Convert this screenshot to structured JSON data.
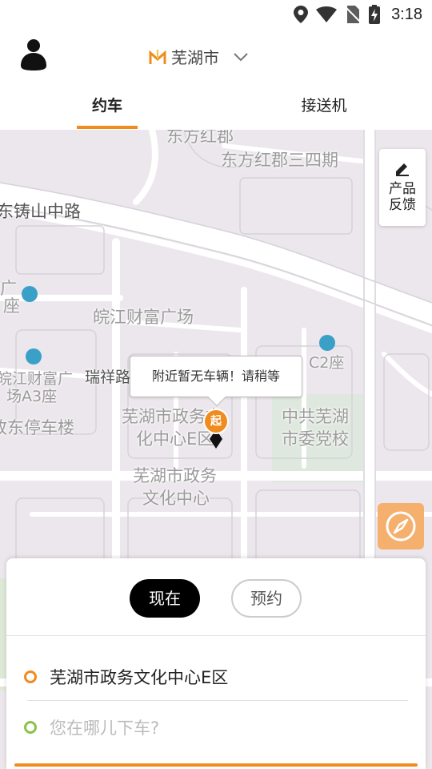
{
  "status_bar": {
    "time": "3:18",
    "icons": [
      "location-icon",
      "wifi-icon",
      "no-sim-icon",
      "battery-charging-icon"
    ]
  },
  "header": {
    "avatar_icon": "person-icon",
    "city_icon": "metro-logo-icon",
    "city": "芜湖市",
    "dropdown_icon": "chevron-down-icon"
  },
  "tabs": [
    {
      "label": "约车",
      "active": true
    },
    {
      "label": "接送机",
      "active": false
    }
  ],
  "map": {
    "labels": [
      "东方红郡",
      "东方红郡三四期",
      "东铸山中路",
      "广",
      "座",
      "皖江财富广场",
      "C2座",
      "皖江财富广",
      "场A3座",
      "瑞祥路",
      "政东停车楼",
      "芜湖市政务文",
      "化中心E区",
      "中共芜湖",
      "市委党校",
      "芜湖市政务",
      "文化中心"
    ],
    "feedback_label": "产品反馈",
    "feedback_icon": "pencil-icon",
    "tooltip": "附近暂无车辆！请稍等",
    "pin_label": "起",
    "locate_icon": "compass-icon",
    "accent_color": "#f08c1e"
  },
  "panel": {
    "mode_now": "现在",
    "mode_reserve": "预约",
    "start_address": "芜湖市政务文化中心E区",
    "destination_placeholder": "您在哪儿下车?",
    "start_dot_color": "#f08c1e",
    "end_dot_color": "#8bc34a"
  }
}
